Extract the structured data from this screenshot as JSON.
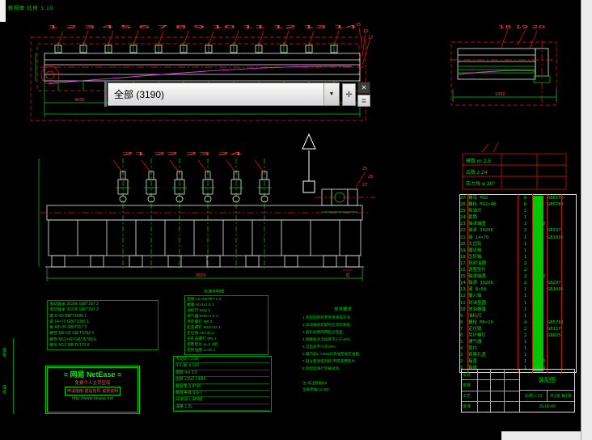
{
  "canvas": {
    "top_note": "俯视图 比例 1:10"
  },
  "palette": {
    "selection_value": "全部 (3190)",
    "dropdown_glyph": "▼",
    "close_glyph": "✕",
    "pickadd_glyph": "✛",
    "quickselect_glyph": "≣"
  },
  "plan_view": {
    "balloons_top": "1 2 3 4 5 6 7 8 9 10 11 12 13 14",
    "balloons_right": [
      "15",
      "16",
      "17"
    ],
    "dim_text": "4000"
  },
  "aux_view": {
    "balloons_top": "18 19 20",
    "dim_text": "1060"
  },
  "front_view": {
    "balloons_top": "21 22 23 24",
    "balloons_right": [
      "25",
      "26",
      "27"
    ],
    "dim_text": "3600",
    "section_label": "B"
  },
  "gear_table": {
    "rows": [
      "模数 m 2.5",
      "齿数 z 24",
      "压力角 α 20°"
    ]
  },
  "parts_list": {
    "rows": [
      {
        "n": "27",
        "name": "螺母 M12",
        "qty": "6",
        "mat": "Q235",
        "rem": "GB6170"
      },
      {
        "n": "26",
        "name": "螺栓 M12×40",
        "qty": "6",
        "mat": "Q235",
        "rem": "GB5783"
      },
      {
        "n": "25",
        "name": "挡油环",
        "qty": "2",
        "mat": "Q235",
        "rem": ""
      },
      {
        "n": "24",
        "name": "套筒",
        "qty": "1",
        "mat": "Q235",
        "rem": ""
      },
      {
        "n": "23",
        "name": "轴承端盖",
        "qty": "2",
        "mat": "HT150",
        "rem": ""
      },
      {
        "n": "22",
        "name": "轴承 30208",
        "qty": "2",
        "mat": "",
        "rem": "GB297"
      },
      {
        "n": "21",
        "name": "键 14×70",
        "qty": "1",
        "mat": "45",
        "rem": "GB1096"
      },
      {
        "n": "20",
        "name": "大齿轮",
        "qty": "1",
        "mat": "45",
        "rem": ""
      },
      {
        "n": "19",
        "name": "输出轴",
        "qty": "1",
        "mat": "45",
        "rem": ""
      },
      {
        "n": "18",
        "name": "齿轮轴",
        "qty": "1",
        "mat": "45",
        "rem": ""
      },
      {
        "n": "17",
        "name": "毡封油圈",
        "qty": "2",
        "mat": "毡",
        "rem": ""
      },
      {
        "n": "16",
        "name": "调整垫片",
        "qty": "2",
        "mat": "08F",
        "rem": ""
      },
      {
        "n": "15",
        "name": "轴承端盖",
        "qty": "2",
        "mat": "HT150",
        "rem": ""
      },
      {
        "n": "14",
        "name": "轴承 30206",
        "qty": "2",
        "mat": "",
        "rem": "GB297"
      },
      {
        "n": "13",
        "name": "键 8×50",
        "qty": "1",
        "mat": "45",
        "rem": "GB1096"
      },
      {
        "n": "12",
        "name": "输入轴",
        "qty": "1",
        "mat": "45",
        "rem": ""
      },
      {
        "n": "11",
        "name": "封油垫圈",
        "qty": "1",
        "mat": "皮革",
        "rem": ""
      },
      {
        "n": "10",
        "name": "放油螺塞",
        "qty": "1",
        "mat": "Q235",
        "rem": ""
      },
      {
        "n": "9",
        "name": "油标尺",
        "qty": "1",
        "mat": "Q235",
        "rem": ""
      },
      {
        "n": "8",
        "name": "螺栓 M6×20",
        "qty": "4",
        "mat": "Q235",
        "rem": "GB5783"
      },
      {
        "n": "7",
        "name": "定位销",
        "qty": "2",
        "mat": "35",
        "rem": "GB117"
      },
      {
        "n": "6",
        "name": "吊环螺钉",
        "qty": "2",
        "mat": "20",
        "rem": "GB825"
      },
      {
        "n": "5",
        "name": "通气器",
        "qty": "1",
        "mat": "Q235",
        "rem": ""
      },
      {
        "n": "4",
        "name": "垫片",
        "qty": "1",
        "mat": "石棉",
        "rem": ""
      },
      {
        "n": "3",
        "name": "观察孔盖",
        "qty": "1",
        "mat": "Q235",
        "rem": ""
      },
      {
        "n": "2",
        "name": "箱盖",
        "qty": "1",
        "mat": "HT200",
        "rem": ""
      },
      {
        "n": "1",
        "name": "箱体",
        "qty": "1",
        "mat": "HT200",
        "rem": ""
      }
    ]
  },
  "std_table": {
    "rows": [
      "滚动轴承 30206 GB/T297 2",
      "滚动轴承 30208 GB/T297 2",
      "键 8×50 GB/T1096 1",
      "键 14×70 GB/T1096 1",
      "销 A8×30 GB/T117 2",
      "螺栓 M6×20 GB/T5783 4",
      "螺栓 M12×40 GB/T5783 6",
      "螺母 M12 GB/T6170 6"
    ]
  },
  "detail_table": {
    "title": "标准件明细",
    "rows": [
      "垫圈 12 GB/T97.1 6",
      "螺塞 M14×1.5 1",
      "油标尺 M12 1",
      "通气器 M18×1.5 1",
      "吊环螺钉 M8 2",
      "起盖螺钉 M10×35 1",
      "定位销 A8×30 2",
      "视孔盖螺钉 M6 4",
      "调整垫片 Δ=2 2组",
      "毡封油圈 d=30 2"
    ]
  },
  "spec_table": {
    "rows": [
      "传动比 i 3.95",
      "中心距 a 160",
      "模数 mn 2.5",
      "齿数 z1/z2 24/95",
      "螺旋角 β 8°06′",
      "精度等级 8-8-7",
      "润滑油 L-AN68",
      "油量 1.5L"
    ]
  },
  "notes": {
    "title": "技术要求",
    "lines": [
      "1.装配前所有零件须清洗干净;",
      "2.滚动轴承装配时应涂润滑脂;",
      "3.齿轮副侧隙用铅丝检查;",
      "4.接触斑点沿齿高不小于40%;",
      "5.沿齿长不小于50%;",
      "6.箱内装L-AN68润滑油至规定油面;",
      "7.剖分面涂密封胶,不得使用垫片;",
      "8.装配后进行空载试验。"
    ],
    "footer": [
      "注:未注圆角R3",
      "全部倒角C1×45°"
    ]
  },
  "title_block": {
    "row_labels": [
      "设计",
      "校核",
      "工艺",
      "批准"
    ],
    "name": "装配图",
    "scale": "比例 1:10",
    "sheet": "共1张 第1张",
    "no": "JS-00-00"
  },
  "netease": {
    "line1": "≡ 网易 NetEase ≡",
    "line2": "免费个人主页空间",
    "inner": "申请指南·建站向导·资费说明",
    "url": "http://www.nease.net"
  },
  "margins": {
    "v1": "描图",
    "v2": "描校"
  }
}
